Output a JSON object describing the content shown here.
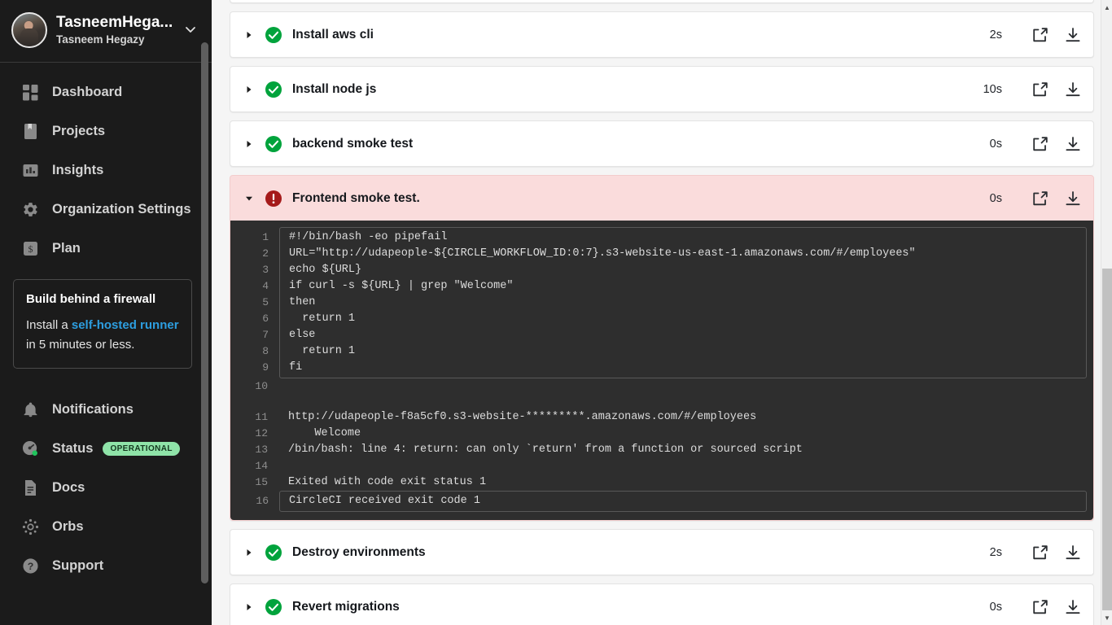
{
  "sidebar": {
    "org": {
      "name": "TasneemHega...",
      "user": "Tasneem Hegazy",
      "chevron_icon": "chevron-down-icon",
      "avatar_icon": "avatar"
    },
    "nav": [
      {
        "label": "Dashboard",
        "icon": "dashboard-icon"
      },
      {
        "label": "Projects",
        "icon": "projects-icon"
      },
      {
        "label": "Insights",
        "icon": "insights-icon"
      },
      {
        "label": "Organization Settings",
        "icon": "gear-icon"
      },
      {
        "label": "Plan",
        "icon": "dollar-icon"
      }
    ],
    "promo": {
      "title": "Build behind a firewall",
      "text_before": "Install a ",
      "link": "self-hosted runner",
      "text_after": " in 5 minutes or less."
    },
    "nav_bottom": [
      {
        "label": "Notifications",
        "icon": "bell-icon",
        "badge": ""
      },
      {
        "label": "Status",
        "icon": "gauge-icon",
        "badge": "OPERATIONAL"
      },
      {
        "label": "Docs",
        "icon": "document-icon",
        "badge": ""
      },
      {
        "label": "Orbs",
        "icon": "orbs-icon",
        "badge": ""
      },
      {
        "label": "Support",
        "icon": "question-circle-icon",
        "badge": ""
      }
    ]
  },
  "colors": {
    "success": "#00a33c",
    "failed": "#a51b1b",
    "failed_bg": "#fadcdc",
    "link": "#2d9ee0",
    "badge_bg": "#8fe3a8",
    "terminal_bg": "#2e2e2e",
    "sidebar_bg": "#1b1b1b"
  },
  "steps": [
    {
      "name": "Install aws cli",
      "status": "success",
      "duration": "2s",
      "expanded": false
    },
    {
      "name": "Install node js",
      "status": "success",
      "duration": "10s",
      "expanded": false
    },
    {
      "name": "backend smoke test",
      "status": "success",
      "duration": "0s",
      "expanded": false
    },
    {
      "name": "Frontend smoke test.",
      "status": "failed",
      "duration": "0s",
      "expanded": true
    },
    {
      "name": "Destroy environments",
      "status": "success",
      "duration": "2s",
      "expanded": false
    },
    {
      "name": "Revert migrations",
      "status": "success",
      "duration": "0s",
      "expanded": false
    }
  ],
  "step_actions": {
    "open_icon": "external-link-icon",
    "download_icon": "download-icon"
  },
  "terminal": {
    "script_lines": [
      {
        "num": "1",
        "text": "#!/bin/bash -eo pipefail"
      },
      {
        "num": "2",
        "text": "URL=\"http://udapeople-${CIRCLE_WORKFLOW_ID:0:7}.s3-website-us-east-1.amazonaws.com/#/employees\""
      },
      {
        "num": "3",
        "text": "echo ${URL}"
      },
      {
        "num": "4",
        "text": "if curl -s ${URL} | grep \"Welcome\""
      },
      {
        "num": "5",
        "text": "then"
      },
      {
        "num": "6",
        "text": "  return 1"
      },
      {
        "num": "7",
        "text": "else"
      },
      {
        "num": "8",
        "text": "  return 1"
      },
      {
        "num": "9",
        "text": "fi"
      }
    ],
    "blank_line_num": "10",
    "output_lines": [
      {
        "num": "11",
        "text": "http://udapeople-f8a5cf0.s3-website-*********.amazonaws.com/#/employees"
      },
      {
        "num": "12",
        "text": "    Welcome"
      },
      {
        "num": "13",
        "text": "/bin/bash: line 4: return: can only `return' from a function or sourced script"
      },
      {
        "num": "14",
        "text": ""
      },
      {
        "num": "15",
        "text": "Exited with code exit status 1"
      }
    ],
    "exit_line": {
      "num": "16",
      "text": "CircleCI received exit code 1"
    }
  },
  "scrollbars": {
    "sidebar_thumb": true,
    "page_up_arrow": "scroll-up-arrow",
    "page_down_arrow": "scroll-down-arrow"
  }
}
